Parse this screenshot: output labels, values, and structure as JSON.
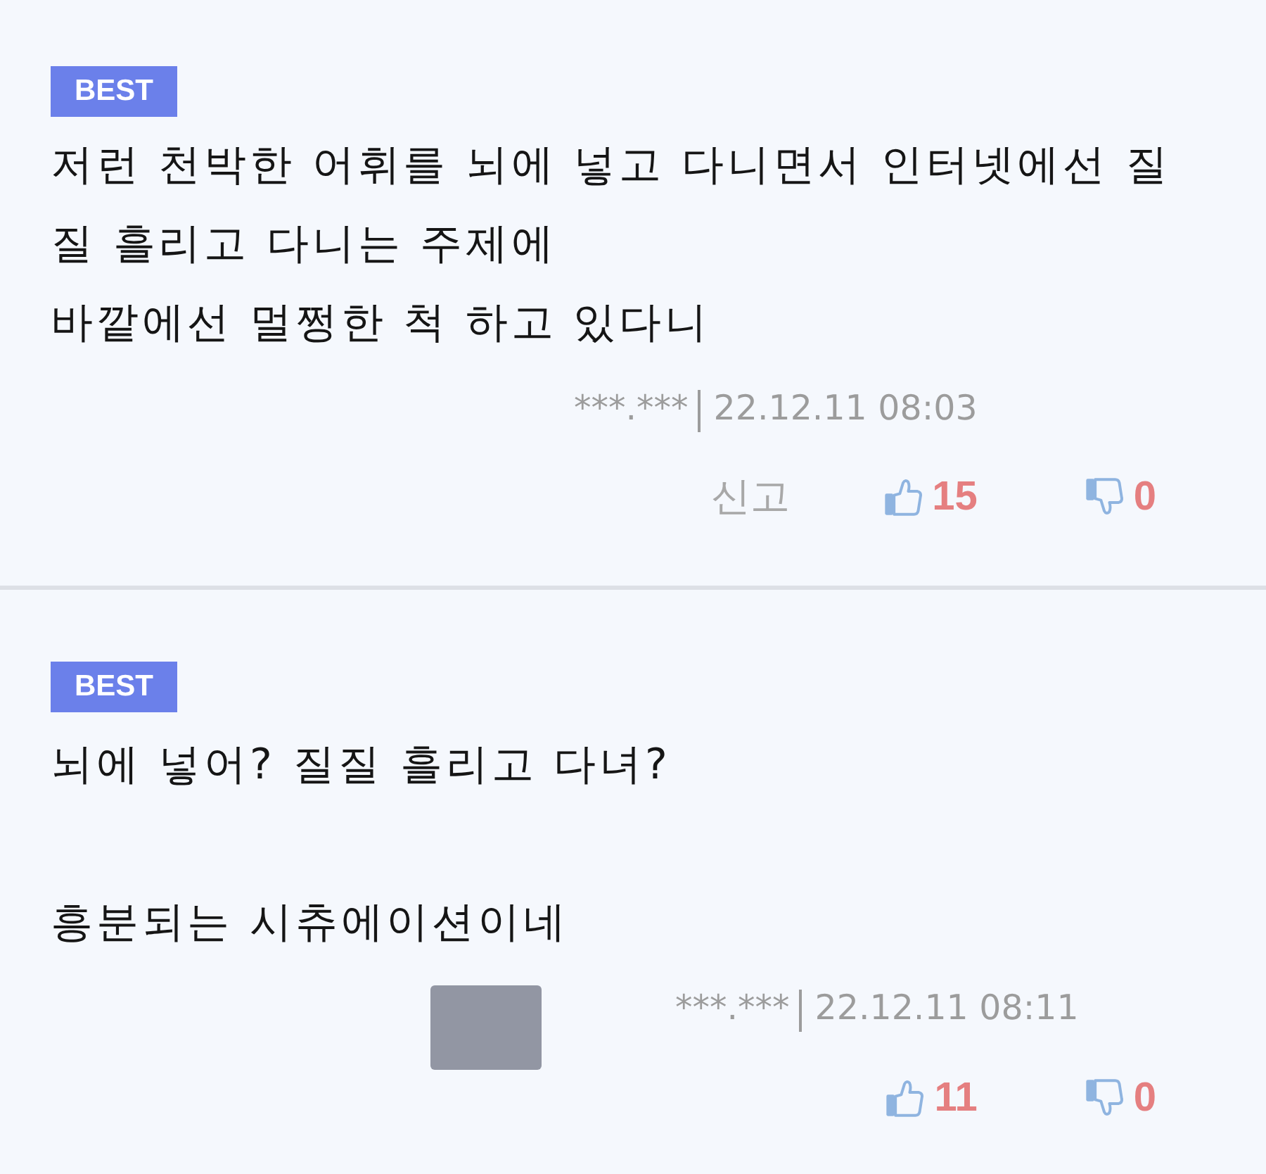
{
  "comments": [
    {
      "badge": "BEST",
      "text": "저런 천박한 어휘를 뇌에 넣고 다니면서 인터넷에선 질\n질 흘리고 다니는 주제에\n바깥에선 멀쩡한 척 하고 있다니",
      "redacted": false,
      "author_ip": "***.***",
      "date": "22.12.11 08:03",
      "report": "신고",
      "likes": "15",
      "dislikes": "0"
    },
    {
      "badge": "BEST",
      "text": "뇌에 넣어? 질질 흘리고 다녀?\n\n흥분되는 시츄에이션이네",
      "redacted": true,
      "author_ip": "***.***",
      "date": "22.12.11 08:11",
      "likes": "11",
      "dislikes": "0"
    }
  ]
}
